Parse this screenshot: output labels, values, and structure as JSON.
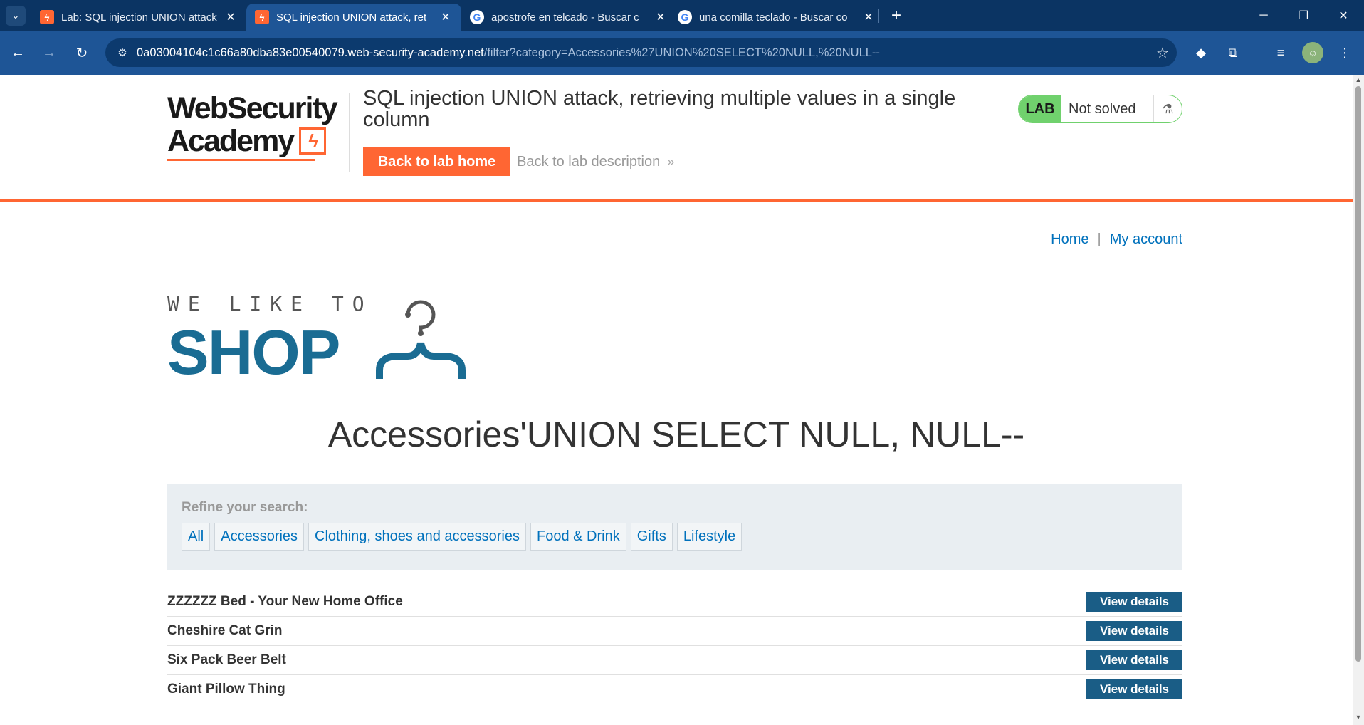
{
  "browser": {
    "tabs": [
      {
        "title": "Lab: SQL injection UNION attack",
        "favicon": "portswigger-icon",
        "active": false
      },
      {
        "title": "SQL injection UNION attack, ret",
        "favicon": "portswigger-icon",
        "active": true
      },
      {
        "title": "apostrofe en telcado - Buscar c",
        "favicon": "google-icon",
        "active": false
      },
      {
        "title": "una comilla teclado - Buscar co",
        "favicon": "google-icon",
        "active": false
      }
    ],
    "url_host": "0a03004104c1c66a80dba83e00540079.web-security-academy.net",
    "url_path": "/filter?category=Accessories%27UNION%20SELECT%20NULL,%20NULL--"
  },
  "academy": {
    "logo_line1": "WebSecurity",
    "logo_line2": "Academy",
    "lab_title": "SQL injection UNION attack, retrieving multiple values in a single column",
    "back_home": "Back to lab home",
    "back_description": "Back to lab description",
    "status_badge": "LAB",
    "status_text": "Not solved"
  },
  "nav": {
    "home": "Home",
    "separator": "|",
    "my_account": "My account"
  },
  "shop_logo": {
    "tagline": "WE LIKE TO",
    "word": "SHOP"
  },
  "category_heading": "Accessories'UNION SELECT NULL, NULL--",
  "refine": {
    "label": "Refine your search:",
    "filters": [
      "All",
      "Accessories",
      "Clothing, shoes and accessories",
      "Food & Drink",
      "Gifts",
      "Lifestyle"
    ]
  },
  "products": [
    {
      "name": "ZZZZZZ Bed - Your New Home Office",
      "action": "View details"
    },
    {
      "name": "Cheshire Cat Grin",
      "action": "View details"
    },
    {
      "name": "Six Pack Beer Belt",
      "action": "View details"
    },
    {
      "name": "Giant Pillow Thing",
      "action": "View details"
    }
  ],
  "colors": {
    "accent": "#ff6633",
    "link": "#0071bc",
    "button": "#1a5d86",
    "lab_badge": "#70d16d"
  }
}
